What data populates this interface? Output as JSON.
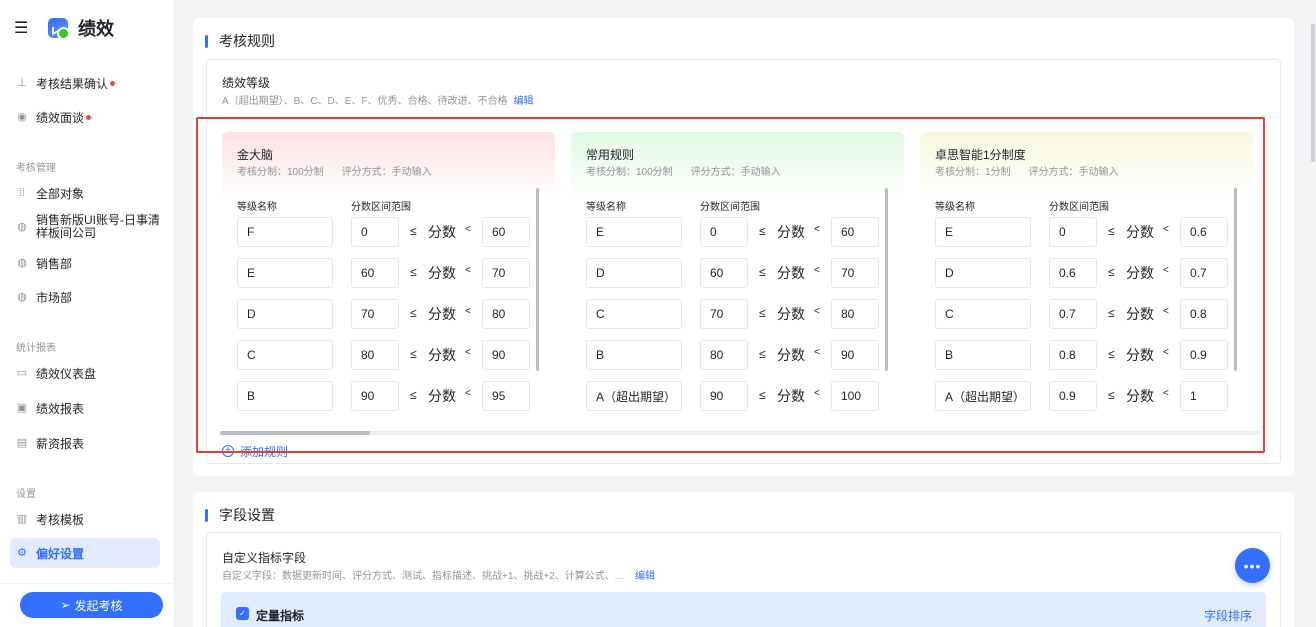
{
  "app": {
    "title": "绩效"
  },
  "sidebar": {
    "top_items": [
      {
        "label": "考核结果确认",
        "badge": true
      },
      {
        "label": "绩效面谈",
        "badge": true
      }
    ],
    "groups": [
      {
        "label": "考核管理",
        "items": [
          "全部对象",
          "销售新版UI账号-日事清样板间公司",
          "销售部",
          "市场部"
        ]
      },
      {
        "label": "统计报表",
        "items": [
          "绩效仪表盘",
          "绩效报表",
          "薪资报表"
        ]
      },
      {
        "label": "设置",
        "items": [
          "考核模板",
          "偏好设置"
        ]
      }
    ],
    "active_item": "偏好设置",
    "launch_button": "发起考核"
  },
  "assessment_rules": {
    "section_title": "考核规则",
    "grade_title": "绩效等级",
    "grade_desc": "A（超出期望）、B、C、D、E、F、优秀、合格、待改进、不合格",
    "edit_label": "编辑",
    "col_grade": "等级名称",
    "col_range": "分数区间范围",
    "le_symbol": "≤",
    "score_label": "分数",
    "lt_symbol": "<",
    "add_rule_label": "添加规则",
    "rules": [
      {
        "name": "金大脑",
        "score_system": "考核分制：100分制",
        "method": "评分方式：手动输入",
        "header_color": "#fde2e2",
        "rows": [
          {
            "grade": "F",
            "min": "0",
            "max": "60"
          },
          {
            "grade": "E",
            "min": "60",
            "max": "70"
          },
          {
            "grade": "D",
            "min": "70",
            "max": "80"
          },
          {
            "grade": "C",
            "min": "80",
            "max": "90"
          },
          {
            "grade": "B",
            "min": "90",
            "max": "95"
          }
        ]
      },
      {
        "name": "常用规则",
        "score_system": "考核分制：100分制",
        "method": "评分方式：手动输入",
        "header_color": "#e2f8e4",
        "rows": [
          {
            "grade": "E",
            "min": "0",
            "max": "60"
          },
          {
            "grade": "D",
            "min": "60",
            "max": "70"
          },
          {
            "grade": "C",
            "min": "70",
            "max": "80"
          },
          {
            "grade": "B",
            "min": "80",
            "max": "90"
          },
          {
            "grade": "A（超出期望）",
            "min": "90",
            "max": "100"
          }
        ]
      },
      {
        "name": "卓思智能1分制度",
        "score_system": "考核分制：1分制",
        "method": "评分方式：手动输入",
        "header_color": "#f8f8e0",
        "rows": [
          {
            "grade": "E",
            "min": "0",
            "max": "0.6"
          },
          {
            "grade": "D",
            "min": "0.6",
            "max": "0.7"
          },
          {
            "grade": "C",
            "min": "0.7",
            "max": "0.8"
          },
          {
            "grade": "B",
            "min": "0.8",
            "max": "0.9"
          },
          {
            "grade": "A（超出期望）",
            "min": "0.9",
            "max": "1"
          }
        ]
      }
    ]
  },
  "field_settings": {
    "section_title": "字段设置",
    "custom_title": "自定义指标字段",
    "custom_desc": "自定义字段：数据更新时间、评分方式、测试、指标描述、挑战+1、挑战+2、计算公式、...",
    "edit_label": "编辑",
    "metric_title": "定量指标",
    "sort_label": "字段排序"
  },
  "fab_label": "•••",
  "colors": {
    "accent": "#3370ff",
    "highlight_frame": "#e53d2f",
    "badge": "#f54a45"
  }
}
